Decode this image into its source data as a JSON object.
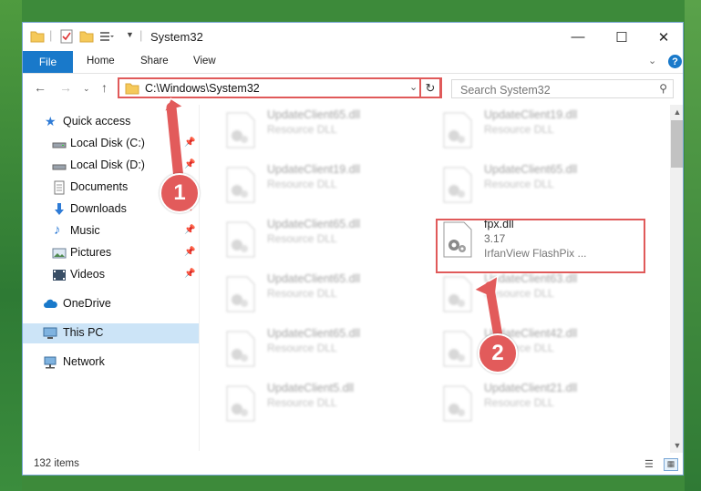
{
  "window": {
    "title": "System32",
    "controls": {
      "minimize": "—",
      "maximize": "☐",
      "close": "✕"
    }
  },
  "ribbon": {
    "tabs": [
      {
        "label": "File",
        "active": true
      },
      {
        "label": "Home"
      },
      {
        "label": "Share"
      },
      {
        "label": "View"
      }
    ]
  },
  "address": {
    "path": "C:\\Windows\\System32",
    "search_placeholder": "Search System32"
  },
  "sidebar": {
    "items": [
      {
        "label": "Quick access",
        "icon": "star-icon",
        "pinned": false
      },
      {
        "label": "Local Disk (C:)",
        "icon": "drive-icon",
        "pinned": true
      },
      {
        "label": "Local Disk (D:)",
        "icon": "drive-icon",
        "pinned": true
      },
      {
        "label": "Documents",
        "icon": "documents-icon",
        "pinned": true
      },
      {
        "label": "Downloads",
        "icon": "downloads-icon",
        "pinned": true
      },
      {
        "label": "Music",
        "icon": "music-icon",
        "pinned": true
      },
      {
        "label": "Pictures",
        "icon": "pictures-icon",
        "pinned": true
      },
      {
        "label": "Videos",
        "icon": "videos-icon",
        "pinned": true
      },
      {
        "label": "OneDrive",
        "icon": "cloud-icon",
        "pinned": false
      },
      {
        "label": "This PC",
        "icon": "computer-icon",
        "pinned": false,
        "active": true
      },
      {
        "label": "Network",
        "icon": "network-icon",
        "pinned": false
      }
    ]
  },
  "files": {
    "col1": [
      {
        "name": "UpdateClient65.dll",
        "desc": "Resource DLL"
      },
      {
        "name": "UpdateClient19.dll",
        "desc": "Resource DLL"
      },
      {
        "name": "UpdateClient65.dll",
        "desc": "Resource DLL"
      },
      {
        "name": "UpdateClient65.dll",
        "desc": "Resource DLL"
      },
      {
        "name": "UpdateClient65.dll",
        "desc": "Resource DLL"
      },
      {
        "name": "UpdateClient5.dll",
        "desc": "Resource DLL"
      }
    ],
    "col2": [
      {
        "name": "UpdateClient19.dll",
        "desc": "Resource DLL"
      },
      {
        "name": "UpdateClient65.dll",
        "desc": "Resource DLL"
      },
      {
        "name": "UpdateClient63.dll",
        "desc": "Resource DLL"
      },
      {
        "name": "UpdateClient42.dll",
        "desc": "Resource DLL"
      },
      {
        "name": "UpdateClient21.dll",
        "desc": "Resource DLL"
      }
    ],
    "selected": {
      "name": "fpx.dll",
      "version": "3.17",
      "desc": "IrfanView FlashPix ..."
    }
  },
  "status": {
    "item_count": "132 items"
  },
  "callouts": {
    "one": "1",
    "two": "2"
  },
  "colors": {
    "accent": "#1979ca",
    "highlight": "#e05a5a",
    "selection": "#cce4f7"
  }
}
